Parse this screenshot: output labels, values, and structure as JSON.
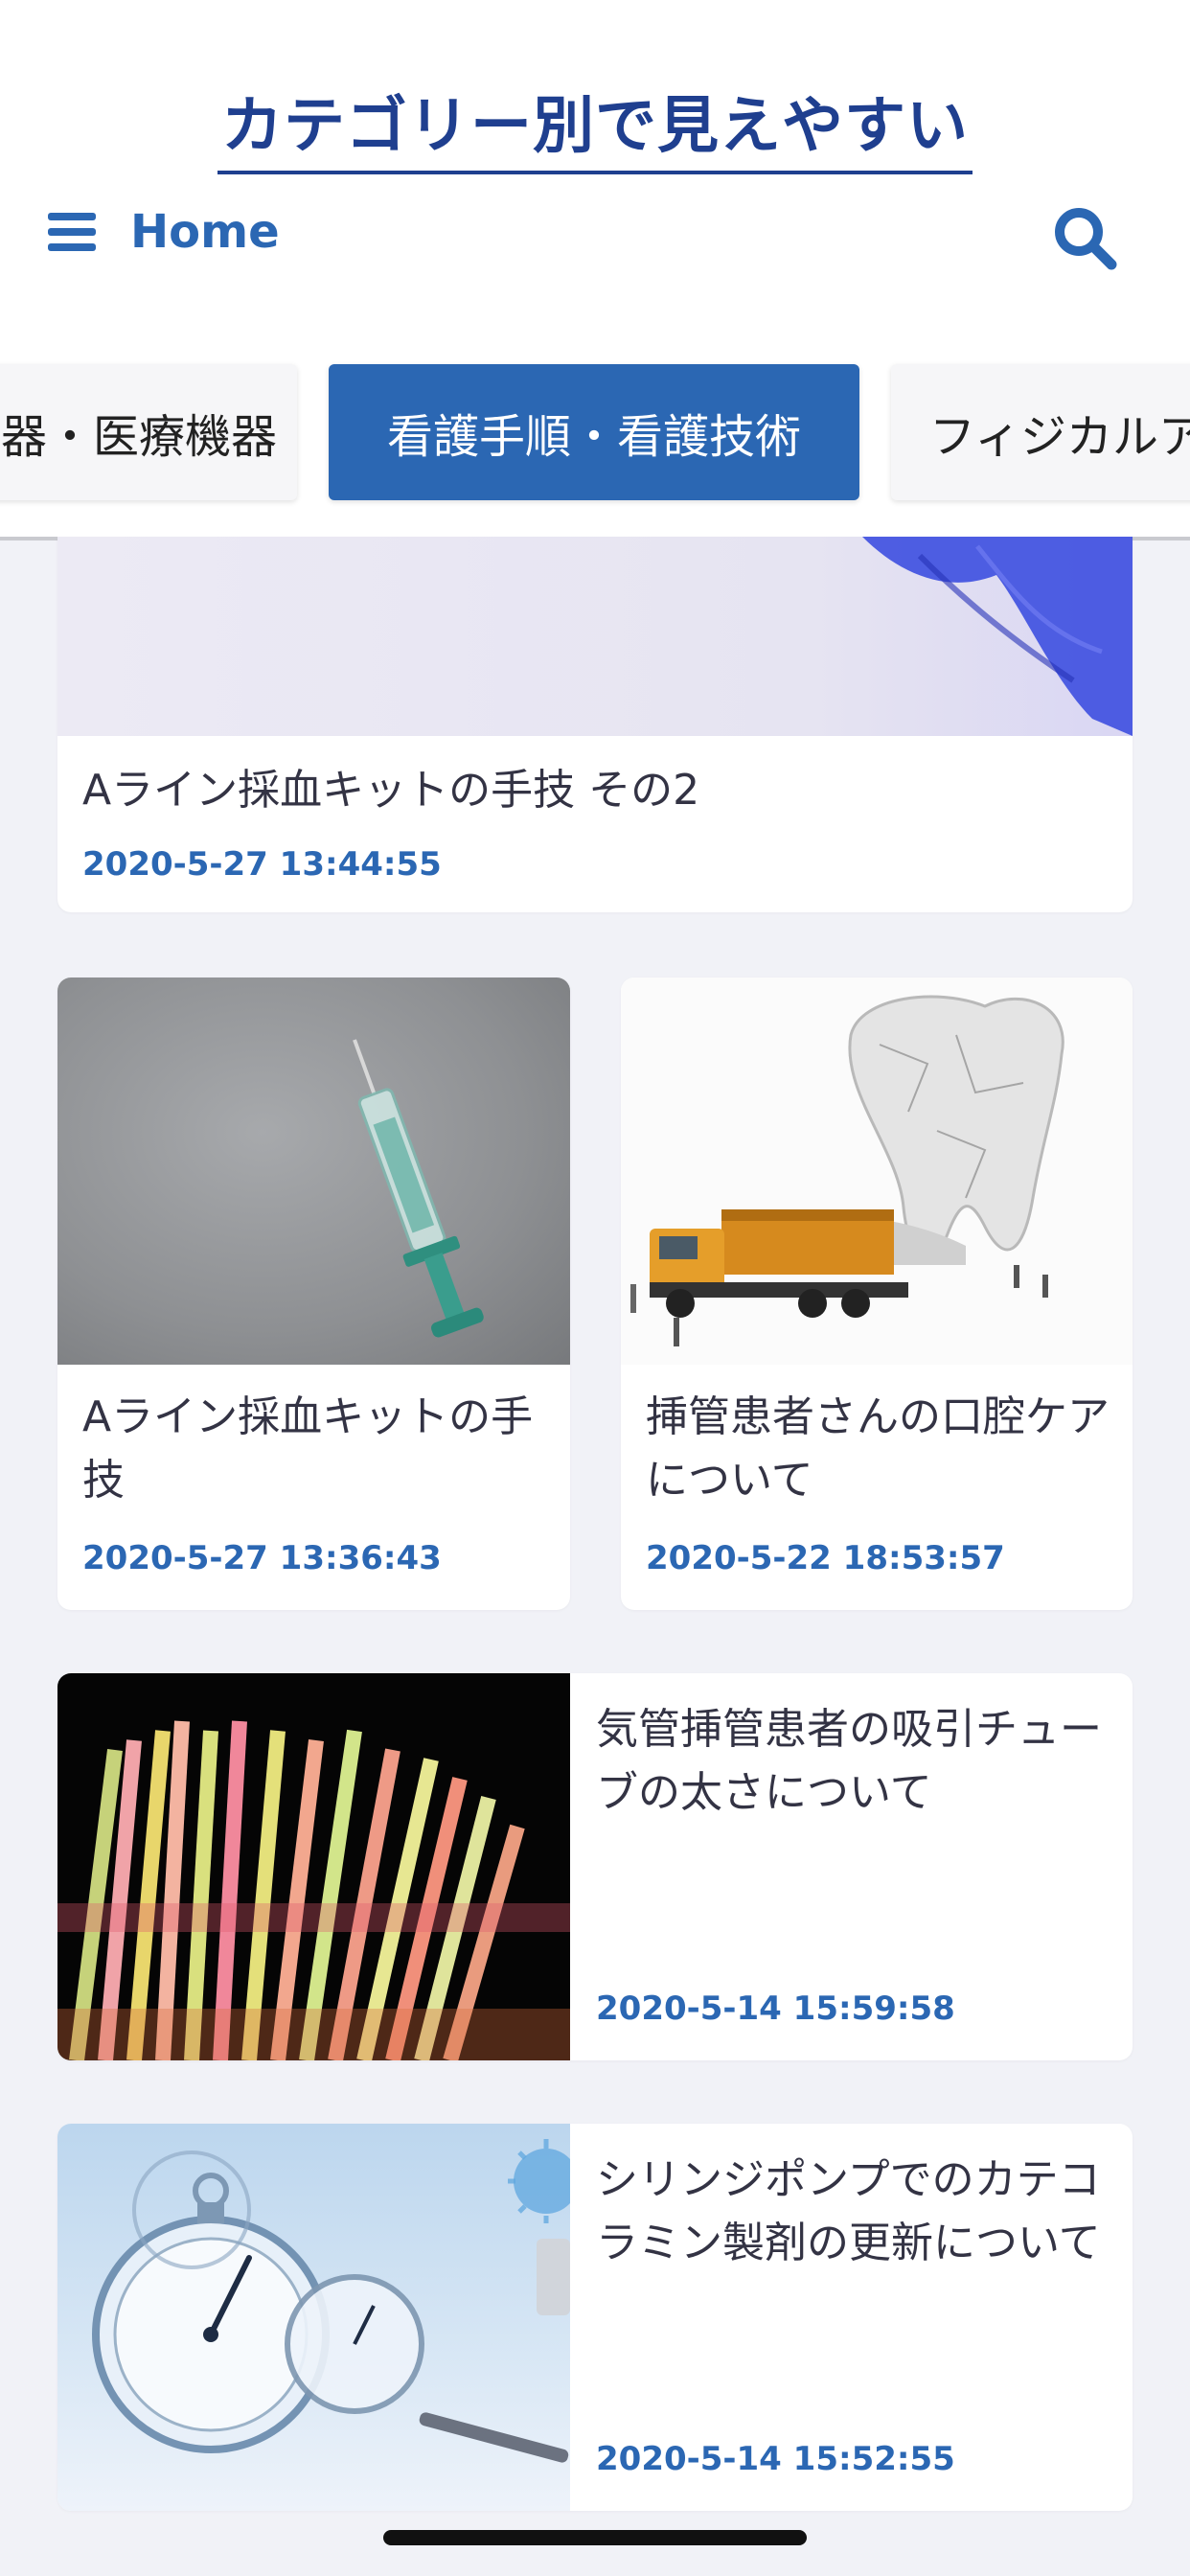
{
  "header": {
    "site_title": "カテゴリー別で見えやすい",
    "menu_label": "Home"
  },
  "tabs": [
    {
      "label": "器・医療機器",
      "active": false
    },
    {
      "label": "看護手順・看護技術",
      "active": true
    },
    {
      "label": "フィジカルア",
      "active": false
    }
  ],
  "colors": {
    "accent": "#2b67b3",
    "title": "#1f3f8f",
    "background": "#f1f2f7"
  },
  "articles": [
    {
      "title": "Aライン採血キットの手技 その2",
      "date": "2020-5-27 13:44:55",
      "image": "glove-image"
    },
    {
      "title": "Aライン採血キットの手技",
      "date": "2020-5-27 13:36:43",
      "image": "syringe-image"
    },
    {
      "title": "挿管患者さんの口腔ケアについて",
      "date": "2020-5-22 18:53:57",
      "image": "tooth-truck-image"
    },
    {
      "title": "気管挿管患者の吸引チューブの太さについて",
      "date": "2020-5-14 15:59:58",
      "image": "straws-image"
    },
    {
      "title": "シリンジポンプでのカテコラミン製剤の更新について",
      "date": "2020-5-14 15:52:55",
      "image": "stopwatch-image"
    }
  ]
}
